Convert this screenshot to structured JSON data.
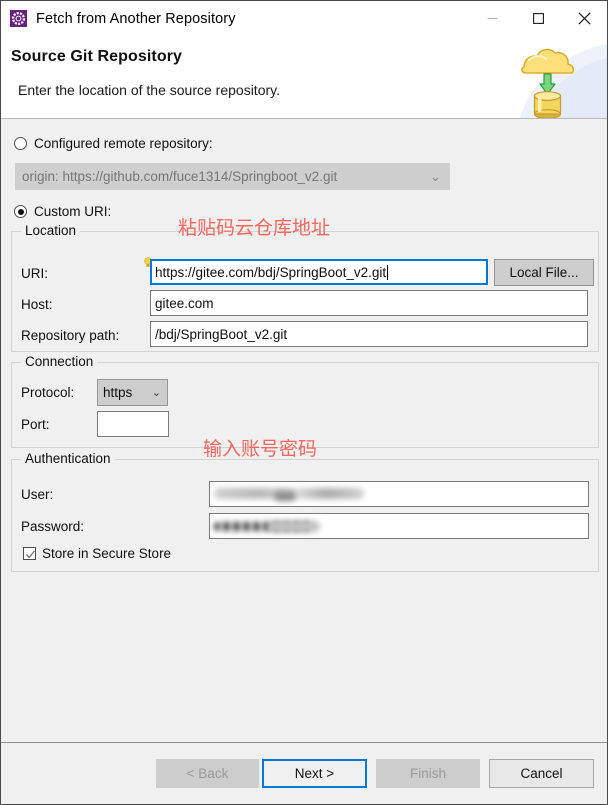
{
  "window": {
    "title": "Fetch from Another Repository",
    "app_icon": "git-gear-icon",
    "controls": {
      "minimize": "minimize-icon",
      "maximize": "maximize-icon",
      "close": "close-icon"
    }
  },
  "header": {
    "title": "Source Git Repository",
    "description": "Enter the location of the source repository.",
    "banner_icon": "cloud-download-to-database-icon"
  },
  "repository_source": {
    "configured": {
      "label": "Configured remote repository:",
      "selected": false,
      "combo_value": "origin: https://github.com/fuce1314/Springboot_v2.git",
      "combo_enabled": false,
      "chevron": "⌄"
    },
    "custom": {
      "label": "Custom URI:",
      "selected": true
    }
  },
  "location": {
    "group_title": "Location",
    "uri_label": "URI:",
    "uri_value": "https://gitee.com/bdj/SpringBoot_v2.git",
    "uri_focused": true,
    "local_file_button": "Local File...",
    "host_label": "Host:",
    "host_value": "gitee.com",
    "repo_path_label": "Repository path:",
    "repo_path_value": "/bdj/SpringBoot_v2.git",
    "hint_icon": "lightbulb-icon"
  },
  "connection": {
    "group_title": "Connection",
    "protocol_label": "Protocol:",
    "protocol_value": "https",
    "protocol_chevron": "⌄",
    "port_label": "Port:",
    "port_value": ""
  },
  "authentication": {
    "group_title": "Authentication",
    "user_label": "User:",
    "user_value": "",
    "password_label": "Password:",
    "password_value": "",
    "store_label": "Store in Secure Store",
    "store_checked": true
  },
  "annotations": [
    {
      "text": "粘贴码云仓库地址",
      "color": "#f4685f"
    },
    {
      "text": "输入账号密码",
      "color": "#f4685f"
    }
  ],
  "footer": {
    "back": "< Back",
    "next": "Next >",
    "finish": "Finish",
    "cancel": "Cancel"
  }
}
